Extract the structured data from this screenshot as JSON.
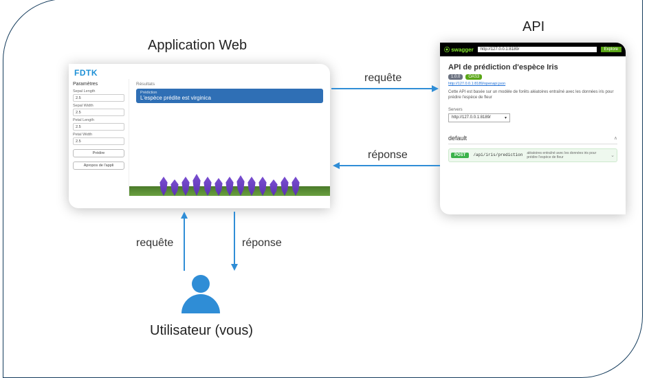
{
  "labels": {
    "webapp": "Application Web",
    "api": "API",
    "user": "Utilisateur (vous)"
  },
  "arrows": {
    "req_web_api": "requête",
    "res_api_web": "réponse",
    "req_user_web": "requête",
    "res_web_user": "réponse"
  },
  "webapp": {
    "logo": "FDTK",
    "params_title": "Paramètres",
    "fields": {
      "sepal_length_label": "Sepal Length",
      "sepal_length_value": "2.5",
      "sepal_width_label": "Sepal Width",
      "sepal_width_value": "2.5",
      "petal_length_label": "Petal Length",
      "petal_length_value": "2.5",
      "petal_width_label": "Petal Width",
      "petal_width_value": "2.5"
    },
    "predict_btn": "Prédire",
    "about_btn": "Apropos de l'appli",
    "results_title": "Résultats",
    "prediction_heading": "Prédiction",
    "prediction_text": "L'espèce prédite est virginica"
  },
  "api": {
    "swagger_brand": "swagger",
    "url_input": "http://127.0.0.1:8189/",
    "explore": "Explore",
    "title": "API de prédiction d'espèce Iris",
    "version_badge": "1.0.0",
    "oas_badge": "OAS3",
    "base_link": "http://127.0.0.1:8189/openapi.json",
    "description": "Cette API est basée sur un modèle de forêts aléatoires entraîné avec les données iris pour prédire l'espèce de fleur",
    "servers_label": "Servers",
    "server_value": "http://127.0.0.1:8189/",
    "section": "default",
    "endpoint_method": "POST",
    "endpoint_path": "/api/iris/prediction",
    "endpoint_desc": "aléatoires entraîné avec les données iris pour prédire l'espèce de fleur",
    "chevron_up": "∧",
    "chevron_down": "⌄",
    "select_caret": "▾"
  }
}
